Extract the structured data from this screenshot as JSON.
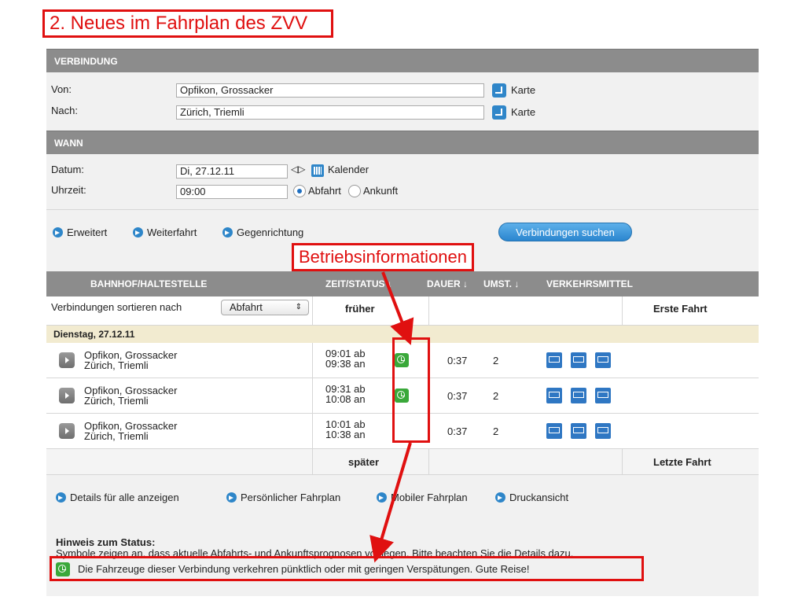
{
  "slide_title": "2. Neues im Fahrplan des ZVV",
  "verbindung": {
    "header": "VERBINDUNG",
    "von_label": "Von:",
    "von_value": "Opfikon, Grossacker",
    "nach_label": "Nach:",
    "nach_value": "Zürich, Triemli",
    "karte_label": "Karte"
  },
  "wann": {
    "header": "WANN",
    "datum_label": "Datum:",
    "datum_value": "Di, 27.12.11",
    "uhrzeit_label": "Uhrzeit:",
    "uhrzeit_value": "09:00",
    "kalender_label": "Kalender",
    "abfahrt_label": "Abfahrt",
    "ankunft_label": "Ankunft",
    "selected_mode": "Abfahrt"
  },
  "options": {
    "erweitert": "Erweitert",
    "weiterfahrt": "Weiterfahrt",
    "gegenrichtung": "Gegenrichtung",
    "search_button": "Verbindungen suchen"
  },
  "annotation_label": "Betriebsinformationen",
  "table": {
    "headers": {
      "station": "BAHNHOF/HALTESTELLE",
      "time": "ZEIT/STATUS ↓",
      "duration": "DAUER ↓",
      "changes": "UMST. ↓",
      "transport": "VERKEHRSMITTEL"
    },
    "sort_label": "Verbindungen sortieren nach",
    "sort_value": "Abfahrt",
    "earlier": "früher",
    "first_trip": "Erste Fahrt",
    "day": "Dienstag, 27.12.11",
    "rows": [
      {
        "from": "Opfikon, Grossacker",
        "to": "Zürich, Triemli",
        "dep": "09:01 ab",
        "arr": "09:38 an",
        "status": "on-time",
        "duration": "0:37",
        "changes": "2"
      },
      {
        "from": "Opfikon, Grossacker",
        "to": "Zürich, Triemli",
        "dep": "09:31 ab",
        "arr": "10:08 an",
        "status": "on-time",
        "duration": "0:37",
        "changes": "2"
      },
      {
        "from": "Opfikon, Grossacker",
        "to": "Zürich, Triemli",
        "dep": "10:01 ab",
        "arr": "10:38 an",
        "status": "",
        "duration": "0:37",
        "changes": "2"
      }
    ],
    "later": "später",
    "last_trip": "Letzte Fahrt"
  },
  "footer_links": {
    "details": "Details für alle anzeigen",
    "personal": "Persönlicher Fahrplan",
    "mobile": "Mobiler Fahrplan",
    "print": "Druckansicht"
  },
  "hint": {
    "title": "Hinweis zum Status:",
    "text": "Symbole zeigen an, dass aktuelle Abfahrts- und Ankunftsprognosen vorliegen. Bitte beachten Sie die Details dazu.",
    "legend": "Die Fahrzeuge dieser Verbindung verkehren pünktlich oder mit geringen Verspätungen. Gute Reise!"
  },
  "colors": {
    "accent_red": "#e01010",
    "header_gray": "#8c8c8c",
    "link_blue": "#2e86c9",
    "status_green": "#3aa83a"
  }
}
